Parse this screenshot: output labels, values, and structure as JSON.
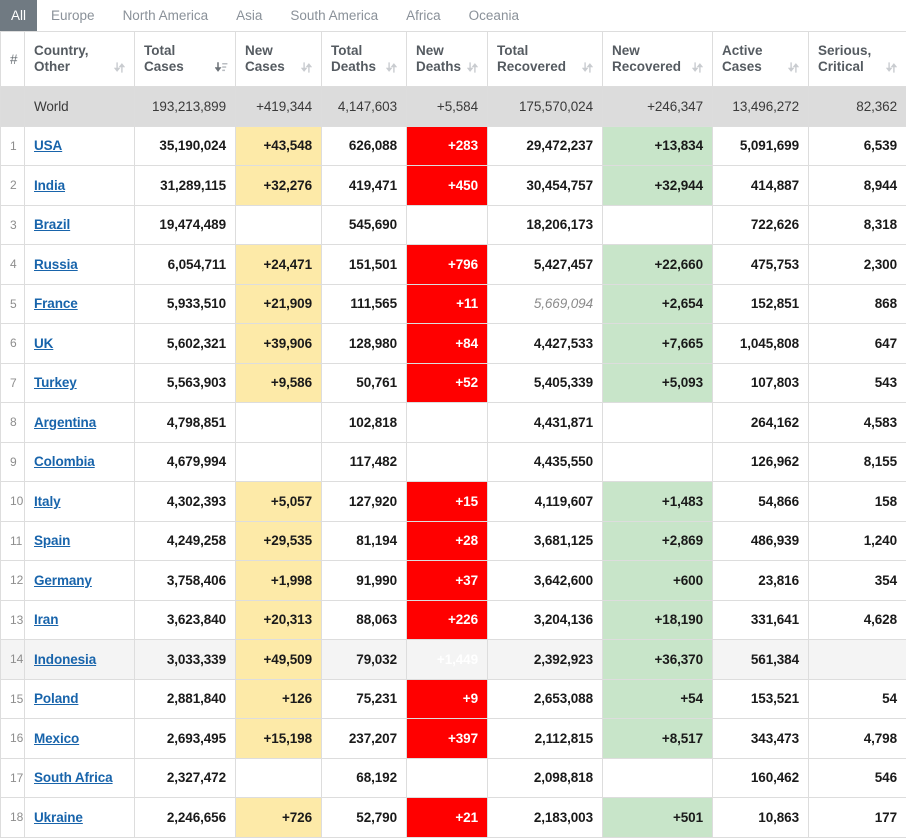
{
  "tabs": [
    {
      "label": "All",
      "active": true
    },
    {
      "label": "Europe",
      "active": false
    },
    {
      "label": "North America",
      "active": false
    },
    {
      "label": "Asia",
      "active": false
    },
    {
      "label": "South America",
      "active": false
    },
    {
      "label": "Africa",
      "active": false
    },
    {
      "label": "Oceania",
      "active": false
    }
  ],
  "table": {
    "columns": [
      {
        "key": "num",
        "line1": "#",
        "line2": "",
        "sort": "none",
        "icon": ""
      },
      {
        "key": "ctry",
        "line1": "Country,",
        "line2": "Other",
        "sort": "sortable",
        "icon": "sort-both-icon"
      },
      {
        "key": "tc",
        "line1": "Total",
        "line2": "Cases",
        "sort": "desc-active",
        "icon": "sort-desc-active-icon"
      },
      {
        "key": "nc",
        "line1": "New",
        "line2": "Cases",
        "sort": "sortable",
        "icon": "sort-both-icon"
      },
      {
        "key": "td",
        "line1": "Total",
        "line2": "Deaths",
        "sort": "sortable",
        "icon": "sort-both-icon"
      },
      {
        "key": "nd",
        "line1": "New",
        "line2": "Deaths",
        "sort": "sortable",
        "icon": "sort-both-icon"
      },
      {
        "key": "tr",
        "line1": "Total",
        "line2": "Recovered",
        "sort": "sortable",
        "icon": "sort-both-icon"
      },
      {
        "key": "nr",
        "line1": "New",
        "line2": "Recovered",
        "sort": "sortable",
        "icon": "sort-both-icon"
      },
      {
        "key": "ac",
        "line1": "Active",
        "line2": "Cases",
        "sort": "sortable",
        "icon": "sort-both-icon"
      },
      {
        "key": "sc",
        "line1": "Serious,",
        "line2": "Critical",
        "sort": "sortable",
        "icon": "sort-both-icon"
      }
    ],
    "world_row": {
      "num": "",
      "country": "World",
      "total_cases": "193,213,899",
      "new_cases": "+419,344",
      "total_deaths": "4,147,603",
      "new_deaths": "+5,584",
      "total_recovered": "175,570,024",
      "new_recovered": "+246,347",
      "active_cases": "13,496,272",
      "serious_critical": "82,362"
    },
    "rows": [
      {
        "num": "1",
        "country": "USA",
        "total_cases": "35,190,024",
        "new_cases": "+43,548",
        "total_deaths": "626,088",
        "new_deaths": "+283",
        "total_recovered": "29,472,237",
        "total_recovered_estimated": false,
        "new_recovered": "+13,834",
        "active_cases": "5,091,699",
        "serious_critical": "6,539",
        "shaded": false
      },
      {
        "num": "2",
        "country": "India",
        "total_cases": "31,289,115",
        "new_cases": "+32,276",
        "total_deaths": "419,471",
        "new_deaths": "+450",
        "total_recovered": "30,454,757",
        "total_recovered_estimated": false,
        "new_recovered": "+32,944",
        "active_cases": "414,887",
        "serious_critical": "8,944",
        "shaded": false
      },
      {
        "num": "3",
        "country": "Brazil",
        "total_cases": "19,474,489",
        "new_cases": "",
        "total_deaths": "545,690",
        "new_deaths": "",
        "total_recovered": "18,206,173",
        "total_recovered_estimated": false,
        "new_recovered": "",
        "active_cases": "722,626",
        "serious_critical": "8,318",
        "shaded": false
      },
      {
        "num": "4",
        "country": "Russia",
        "total_cases": "6,054,711",
        "new_cases": "+24,471",
        "total_deaths": "151,501",
        "new_deaths": "+796",
        "total_recovered": "5,427,457",
        "total_recovered_estimated": false,
        "new_recovered": "+22,660",
        "active_cases": "475,753",
        "serious_critical": "2,300",
        "shaded": false
      },
      {
        "num": "5",
        "country": "France",
        "total_cases": "5,933,510",
        "new_cases": "+21,909",
        "total_deaths": "111,565",
        "new_deaths": "+11",
        "total_recovered": "5,669,094",
        "total_recovered_estimated": true,
        "new_recovered": "+2,654",
        "active_cases": "152,851",
        "serious_critical": "868",
        "shaded": false
      },
      {
        "num": "6",
        "country": "UK",
        "total_cases": "5,602,321",
        "new_cases": "+39,906",
        "total_deaths": "128,980",
        "new_deaths": "+84",
        "total_recovered": "4,427,533",
        "total_recovered_estimated": false,
        "new_recovered": "+7,665",
        "active_cases": "1,045,808",
        "serious_critical": "647",
        "shaded": false
      },
      {
        "num": "7",
        "country": "Turkey",
        "total_cases": "5,563,903",
        "new_cases": "+9,586",
        "total_deaths": "50,761",
        "new_deaths": "+52",
        "total_recovered": "5,405,339",
        "total_recovered_estimated": false,
        "new_recovered": "+5,093",
        "active_cases": "107,803",
        "serious_critical": "543",
        "shaded": false
      },
      {
        "num": "8",
        "country": "Argentina",
        "total_cases": "4,798,851",
        "new_cases": "",
        "total_deaths": "102,818",
        "new_deaths": "",
        "total_recovered": "4,431,871",
        "total_recovered_estimated": false,
        "new_recovered": "",
        "active_cases": "264,162",
        "serious_critical": "4,583",
        "shaded": false
      },
      {
        "num": "9",
        "country": "Colombia",
        "total_cases": "4,679,994",
        "new_cases": "",
        "total_deaths": "117,482",
        "new_deaths": "",
        "total_recovered": "4,435,550",
        "total_recovered_estimated": false,
        "new_recovered": "",
        "active_cases": "126,962",
        "serious_critical": "8,155",
        "shaded": false
      },
      {
        "num": "10",
        "country": "Italy",
        "total_cases": "4,302,393",
        "new_cases": "+5,057",
        "total_deaths": "127,920",
        "new_deaths": "+15",
        "total_recovered": "4,119,607",
        "total_recovered_estimated": false,
        "new_recovered": "+1,483",
        "active_cases": "54,866",
        "serious_critical": "158",
        "shaded": false
      },
      {
        "num": "11",
        "country": "Spain",
        "total_cases": "4,249,258",
        "new_cases": "+29,535",
        "total_deaths": "81,194",
        "new_deaths": "+28",
        "total_recovered": "3,681,125",
        "total_recovered_estimated": false,
        "new_recovered": "+2,869",
        "active_cases": "486,939",
        "serious_critical": "1,240",
        "shaded": false
      },
      {
        "num": "12",
        "country": "Germany",
        "total_cases": "3,758,406",
        "new_cases": "+1,998",
        "total_deaths": "91,990",
        "new_deaths": "+37",
        "total_recovered": "3,642,600",
        "total_recovered_estimated": false,
        "new_recovered": "+600",
        "active_cases": "23,816",
        "serious_critical": "354",
        "shaded": false
      },
      {
        "num": "13",
        "country": "Iran",
        "total_cases": "3,623,840",
        "new_cases": "+20,313",
        "total_deaths": "88,063",
        "new_deaths": "+226",
        "total_recovered": "3,204,136",
        "total_recovered_estimated": false,
        "new_recovered": "+18,190",
        "active_cases": "331,641",
        "serious_critical": "4,628",
        "shaded": false
      },
      {
        "num": "14",
        "country": "Indonesia",
        "total_cases": "3,033,339",
        "new_cases": "+49,509",
        "total_deaths": "79,032",
        "new_deaths": "+1,449",
        "total_recovered": "2,392,923",
        "total_recovered_estimated": false,
        "new_recovered": "+36,370",
        "active_cases": "561,384",
        "serious_critical": "",
        "shaded": true
      },
      {
        "num": "15",
        "country": "Poland",
        "total_cases": "2,881,840",
        "new_cases": "+126",
        "total_deaths": "75,231",
        "new_deaths": "+9",
        "total_recovered": "2,653,088",
        "total_recovered_estimated": false,
        "new_recovered": "+54",
        "active_cases": "153,521",
        "serious_critical": "54",
        "shaded": false
      },
      {
        "num": "16",
        "country": "Mexico",
        "total_cases": "2,693,495",
        "new_cases": "+15,198",
        "total_deaths": "237,207",
        "new_deaths": "+397",
        "total_recovered": "2,112,815",
        "total_recovered_estimated": false,
        "new_recovered": "+8,517",
        "active_cases": "343,473",
        "serious_critical": "4,798",
        "shaded": false
      },
      {
        "num": "17",
        "country": "South Africa",
        "total_cases": "2,327,472",
        "new_cases": "",
        "total_deaths": "68,192",
        "new_deaths": "",
        "total_recovered": "2,098,818",
        "total_recovered_estimated": false,
        "new_recovered": "",
        "active_cases": "160,462",
        "serious_critical": "546",
        "shaded": false
      },
      {
        "num": "18",
        "country": "Ukraine",
        "total_cases": "2,246,656",
        "new_cases": "+726",
        "total_deaths": "52,790",
        "new_deaths": "+21",
        "total_recovered": "2,183,003",
        "total_recovered_estimated": false,
        "new_recovered": "+501",
        "active_cases": "10,863",
        "serious_critical": "177",
        "shaded": false
      }
    ]
  },
  "colors": {
    "new_cases_highlight": "#fdeaa8",
    "new_deaths_highlight": "#ff0000",
    "new_recovered_highlight": "#c8e5c9",
    "world_row_background": "#dcdcdc",
    "active_tab_background": "#707a82",
    "link": "#1864ab"
  }
}
